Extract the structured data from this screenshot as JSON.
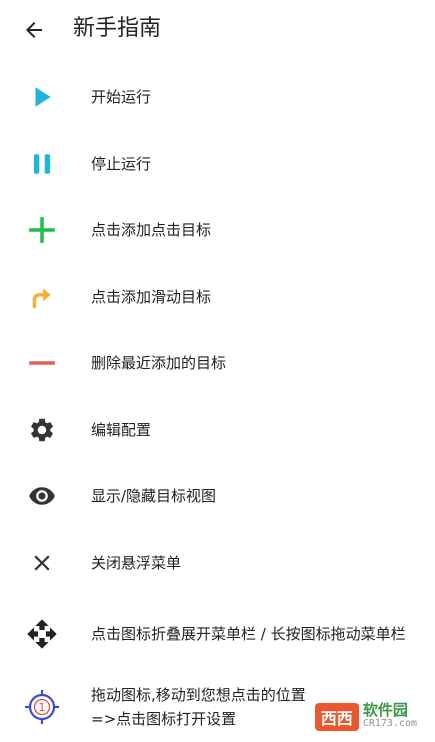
{
  "header": {
    "title": "新手指南"
  },
  "items": [
    {
      "icon": "play-icon",
      "label": "开始运行"
    },
    {
      "icon": "pause-icon",
      "label": "停止运行"
    },
    {
      "icon": "plus-icon",
      "label": "点击添加点击目标"
    },
    {
      "icon": "curved-arrow-icon",
      "label": "点击添加滑动目标"
    },
    {
      "icon": "minus-icon",
      "label": "删除最近添加的目标"
    },
    {
      "icon": "gear-icon",
      "label": "编辑配置"
    },
    {
      "icon": "eye-icon",
      "label": "显示/隐藏目标视图"
    },
    {
      "icon": "close-icon",
      "label": "关闭悬浮菜单"
    },
    {
      "icon": "move-icon",
      "label": "点击图标折叠展开菜单栏 / 长按图标拖动菜单栏"
    },
    {
      "icon": "target-icon",
      "label": "拖动图标,移动到您想点击的位置\n=>点击图标打开设置",
      "target_number": "1"
    }
  ],
  "colors": {
    "play": "#1fb5d6",
    "pause": "#1fb5d6",
    "plus": "#1fbf4a",
    "curved_arrow": "#f2b233",
    "minus": "#e0605a",
    "dark_icon": "#333333",
    "target": "#3a4bd0"
  },
  "watermark": {
    "box": "西西",
    "main": "软件园",
    "sub": "CR173.com"
  }
}
